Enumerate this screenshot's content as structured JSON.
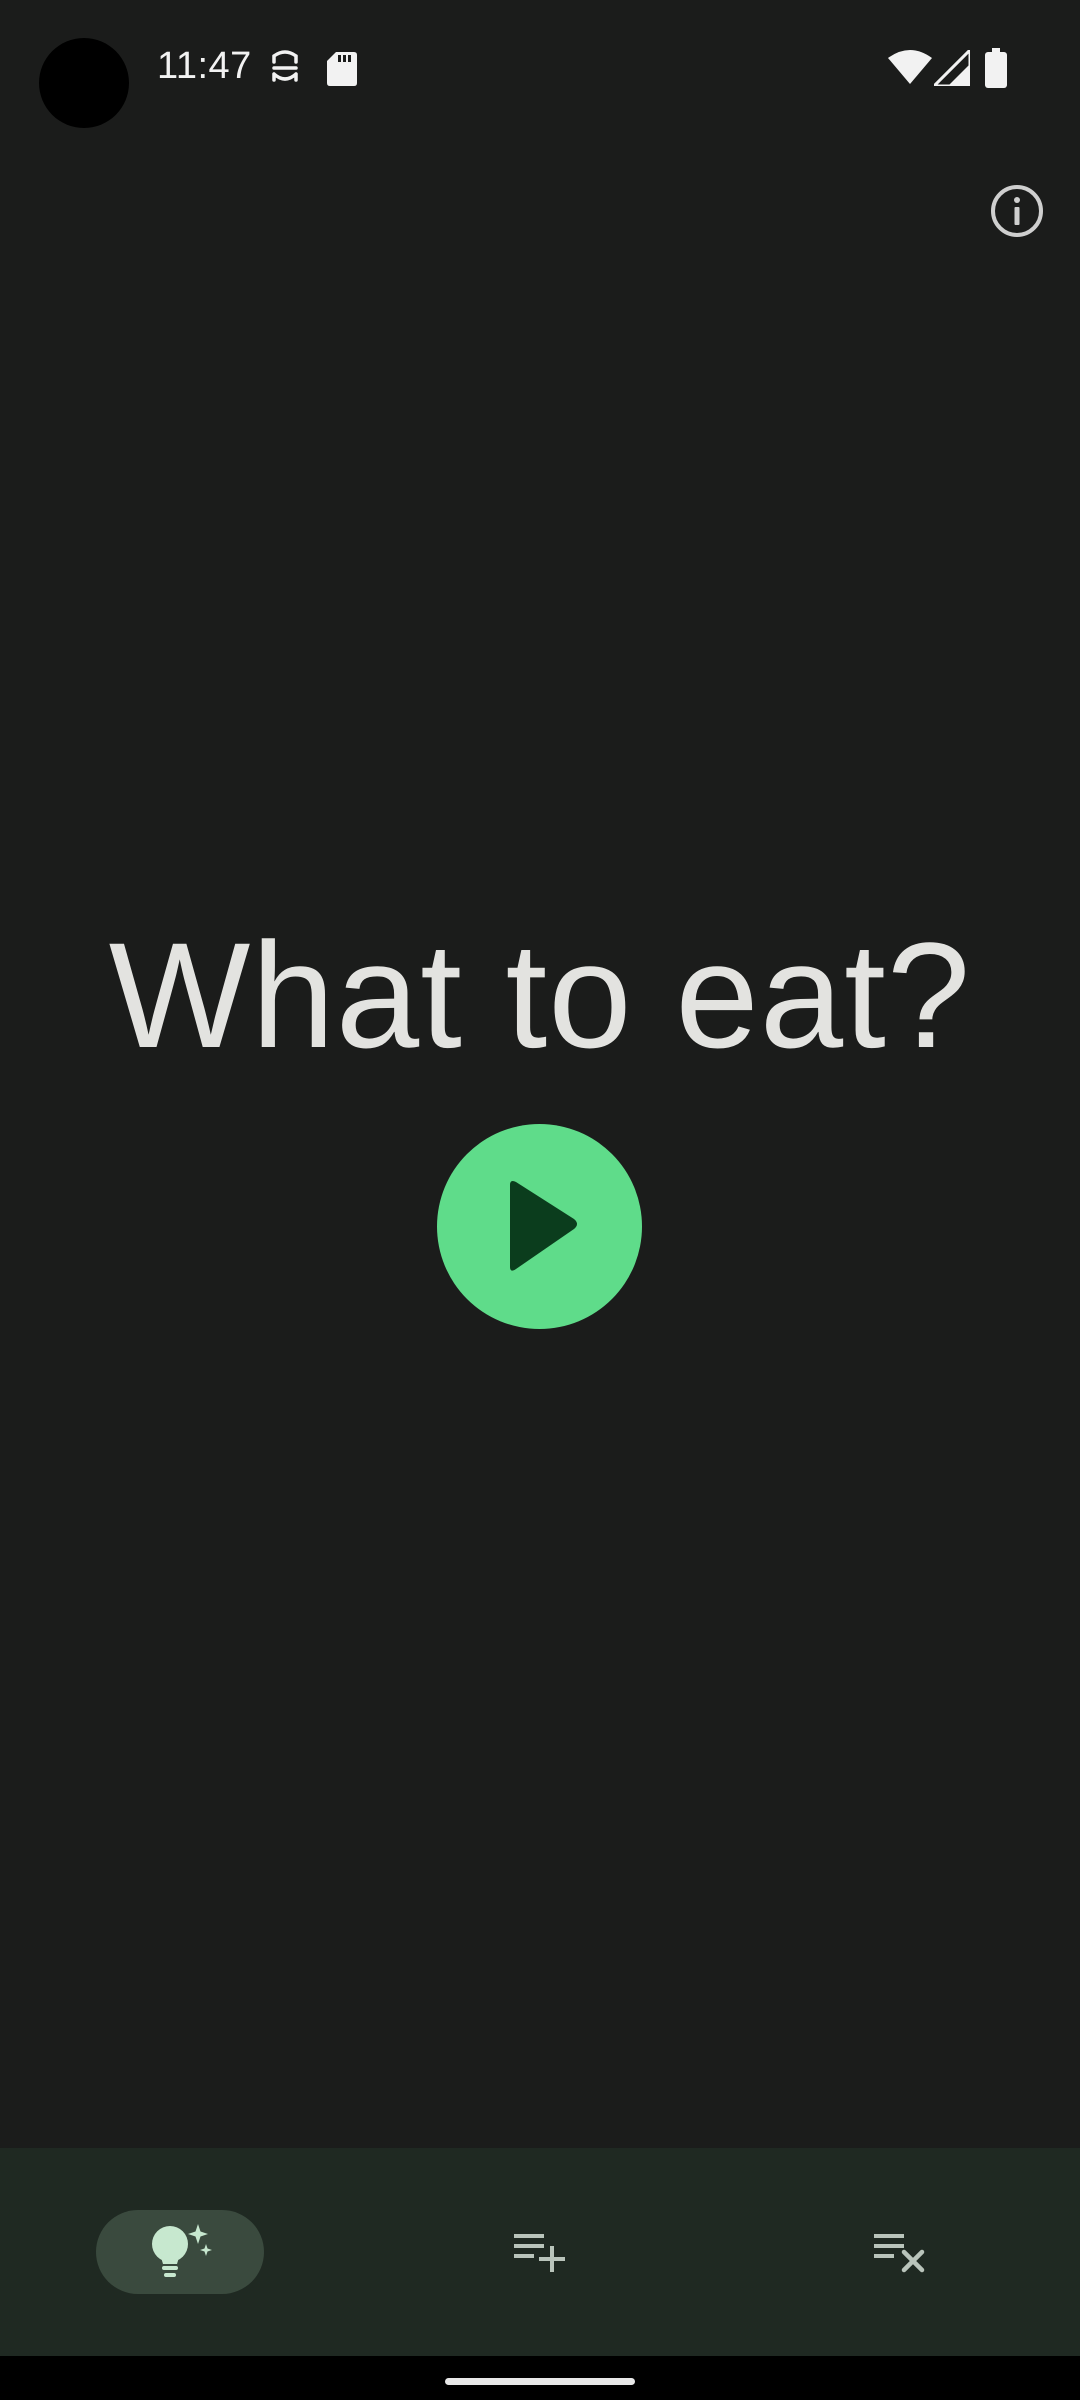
{
  "status_bar": {
    "time": "11:47",
    "icons": [
      "notification-app-icon",
      "sd-card-icon",
      "wifi-icon",
      "signal-icon",
      "battery-icon"
    ]
  },
  "header": {
    "info_icon": "info-icon"
  },
  "main": {
    "headline": "What to eat?",
    "play_icon": "play-icon"
  },
  "bottom_nav": {
    "items": [
      {
        "icon": "lightbulb-sparkle-icon",
        "active": true
      },
      {
        "icon": "playlist-add-icon",
        "active": false
      },
      {
        "icon": "playlist-remove-icon",
        "active": false
      }
    ]
  },
  "colors": {
    "background": "#1b1c1b",
    "accent": "#5fdc8a",
    "accent_dark": "#0b3d1d",
    "nav_background": "#1f2922",
    "nav_active": "#3a4a3e",
    "text": "#e3e3e0"
  }
}
